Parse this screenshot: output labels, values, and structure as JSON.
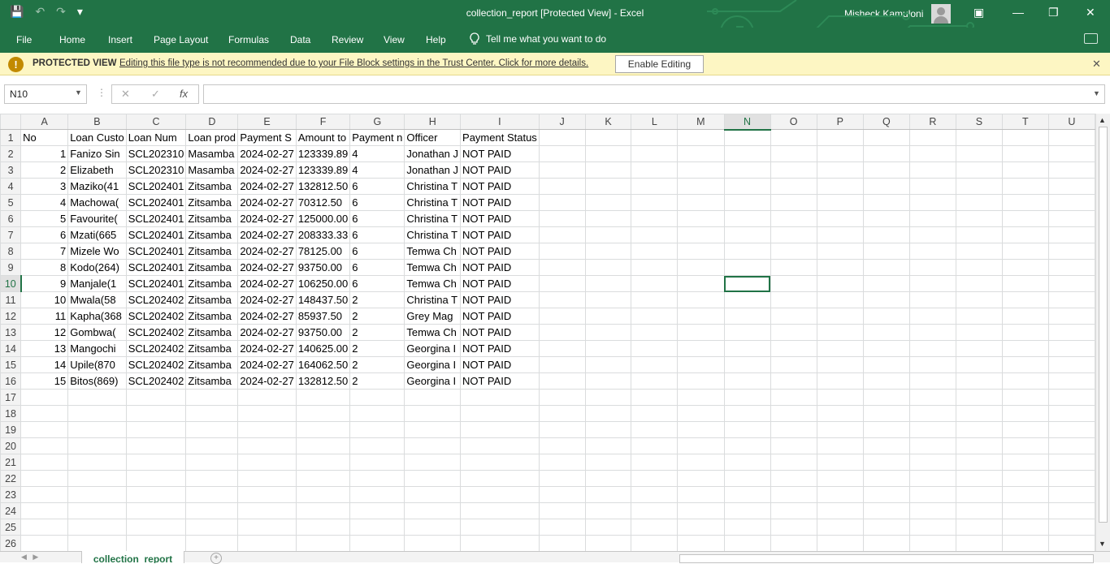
{
  "title_bar": {
    "document_title": "collection_report  [Protected View]  -  Excel",
    "user_name": "Misheck Kamuloni",
    "qat_icons": [
      "save-icon",
      "undo-icon",
      "redo-icon",
      "customize-icon"
    ]
  },
  "ribbon": {
    "tabs": [
      "File",
      "Home",
      "Insert",
      "Page Layout",
      "Formulas",
      "Data",
      "Review",
      "View",
      "Help"
    ],
    "tell_me": "Tell me what you want to do"
  },
  "protected_view": {
    "title": "PROTECTED VIEW",
    "message": "Editing this file type is not recommended due to your File Block settings in the Trust Center. Click for more details.",
    "button_label": "Enable Editing"
  },
  "formula_bar": {
    "name_box": "N10",
    "formula": ""
  },
  "sheet": {
    "columns": [
      "A",
      "B",
      "C",
      "D",
      "E",
      "F",
      "G",
      "H",
      "I",
      "J",
      "K",
      "L",
      "M",
      "N",
      "O",
      "P",
      "Q",
      "R",
      "S",
      "T",
      "U"
    ],
    "selected_column": "N",
    "selected_row": 10,
    "header_row": [
      "No",
      "Loan Custo",
      "Loan Num",
      "Loan prod",
      "Payment S",
      "Amount to",
      "Payment n",
      "Officer",
      "Payment Status"
    ],
    "rows": [
      [
        "1",
        "Fanizo Sin",
        "SCL202310",
        "Masamba",
        "2024-02-27",
        "123339.89",
        "4",
        "Jonathan J",
        "NOT PAID"
      ],
      [
        "2",
        "Elizabeth",
        "SCL202310",
        "Masamba",
        "2024-02-27",
        "123339.89",
        "4",
        "Jonathan J",
        "NOT PAID"
      ],
      [
        "3",
        "Maziko(41",
        "SCL202401",
        "Zitsamba",
        "2024-02-27",
        "132812.50",
        "6",
        "Christina T",
        "NOT PAID"
      ],
      [
        "4",
        "Machowa(",
        "SCL202401",
        "Zitsamba",
        "2024-02-27",
        "70312.50",
        "6",
        "Christina T",
        "NOT PAID"
      ],
      [
        "5",
        "Favourite(",
        "SCL202401",
        "Zitsamba",
        "2024-02-27",
        "125000.00",
        "6",
        "Christina T",
        "NOT PAID"
      ],
      [
        "6",
        "Mzati(665",
        "SCL202401",
        "Zitsamba",
        "2024-02-27",
        "208333.33",
        "6",
        "Christina T",
        "NOT PAID"
      ],
      [
        "7",
        "Mizele Wo",
        "SCL202401",
        "Zitsamba",
        "2024-02-27",
        "78125.00",
        "6",
        "Temwa Ch",
        "NOT PAID"
      ],
      [
        "8",
        "Kodo(264)",
        "SCL202401",
        "Zitsamba",
        "2024-02-27",
        "93750.00",
        "6",
        "Temwa Ch",
        "NOT PAID"
      ],
      [
        "9",
        "Manjale(1",
        "SCL202401",
        "Zitsamba",
        "2024-02-27",
        "106250.00",
        "6",
        "Temwa Ch",
        "NOT PAID"
      ],
      [
        "10",
        "Mwala(58",
        "SCL202402",
        "Zitsamba",
        "2024-02-27",
        "148437.50",
        "2",
        "Christina T",
        "NOT PAID"
      ],
      [
        "11",
        "Kapha(368",
        "SCL202402",
        "Zitsamba",
        "2024-02-27",
        "85937.50",
        "2",
        "Grey Mag",
        "NOT PAID"
      ],
      [
        "12",
        "Gombwa(",
        "SCL202402",
        "Zitsamba",
        "2024-02-27",
        "93750.00",
        "2",
        "Temwa Ch",
        "NOT PAID"
      ],
      [
        "13",
        "Mangochi",
        "SCL202402",
        "Zitsamba",
        "2024-02-27",
        "140625.00",
        "2",
        "Georgina I",
        "NOT PAID"
      ],
      [
        "14",
        "Upile(870",
        "SCL202402",
        "Zitsamba",
        "2024-02-27",
        "164062.50",
        "2",
        "Georgina I",
        "NOT PAID"
      ],
      [
        "15",
        "Bitos(869)",
        "SCL202402",
        "Zitsamba",
        "2024-02-27",
        "132812.50",
        "2",
        "Georgina I",
        "NOT PAID"
      ]
    ],
    "total_rows": 26
  },
  "sheet_tabs": {
    "active": "collection_report"
  },
  "colors": {
    "accent": "#217346",
    "banner": "#fdf6c3"
  }
}
